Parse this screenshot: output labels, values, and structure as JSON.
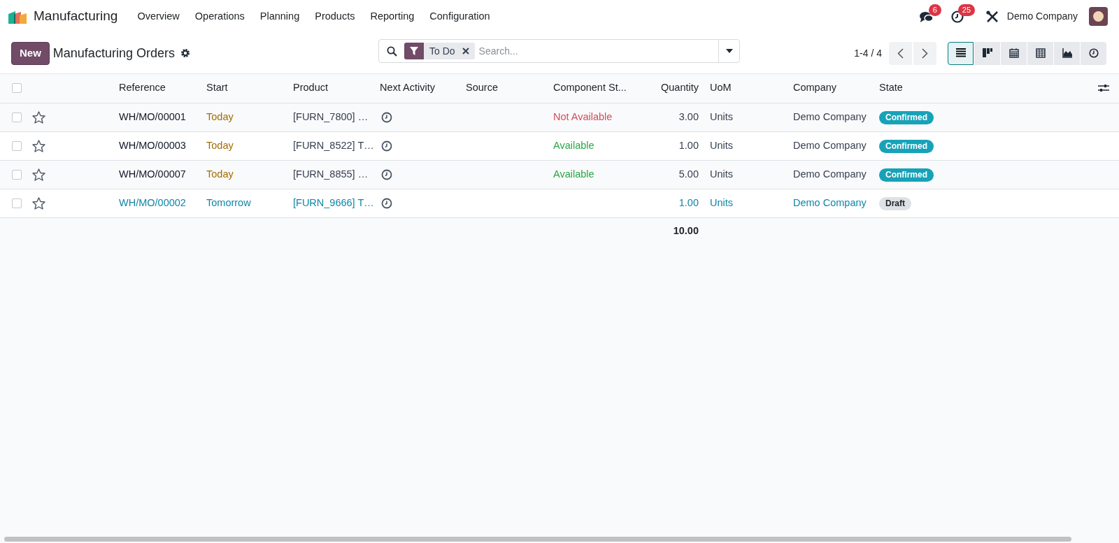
{
  "app": {
    "name": "Manufacturing"
  },
  "menu": [
    "Overview",
    "Operations",
    "Planning",
    "Products",
    "Reporting",
    "Configuration"
  ],
  "systray": {
    "messages_count": "6",
    "activities_count": "25",
    "company": "Demo Company"
  },
  "control_panel": {
    "new_button": "New",
    "title": "Manufacturing Orders",
    "facets": [
      {
        "label": "To Do"
      }
    ],
    "search_placeholder": "Search...",
    "pager": "1-4 / 4",
    "views": [
      {
        "kind": "list",
        "selected": true
      },
      {
        "kind": "kanban",
        "selected": false
      },
      {
        "kind": "calendar",
        "selected": false
      },
      {
        "kind": "pivot",
        "selected": false
      },
      {
        "kind": "graph",
        "selected": false
      },
      {
        "kind": "activity",
        "selected": false
      }
    ]
  },
  "table": {
    "select_all": {
      "checked": false
    },
    "columns": [
      "Reference",
      "Start",
      "Product",
      "Next Activity",
      "Source",
      "Component St...",
      "Quantity",
      "UoM",
      "Company",
      "State"
    ],
    "rows": [
      {
        "selected": false,
        "starred": false,
        "reference": "WH/MO/00001",
        "start": {
          "text": "Today",
          "kind": "today"
        },
        "product": "[FURN_7800] …",
        "component_status": {
          "text": "Not Available",
          "kind": "unavailable"
        },
        "quantity": "3.00",
        "uom": "Units",
        "company": "Demo Company",
        "state": {
          "label": "Confirmed",
          "kind": "confirmed"
        }
      },
      {
        "selected": false,
        "starred": false,
        "reference": "WH/MO/00003",
        "start": {
          "text": "Today",
          "kind": "today"
        },
        "product": "[FURN_8522] T…",
        "component_status": {
          "text": "Available",
          "kind": "available"
        },
        "quantity": "1.00",
        "uom": "Units",
        "company": "Demo Company",
        "state": {
          "label": "Confirmed",
          "kind": "confirmed"
        }
      },
      {
        "selected": false,
        "starred": false,
        "reference": "WH/MO/00007",
        "start": {
          "text": "Today",
          "kind": "today"
        },
        "product": "[FURN_8855] …",
        "component_status": {
          "text": "Available",
          "kind": "available"
        },
        "quantity": "5.00",
        "uom": "Units",
        "company": "Demo Company",
        "state": {
          "label": "Confirmed",
          "kind": "confirmed"
        }
      },
      {
        "selected": false,
        "starred": false,
        "reference": "WH/MO/00002",
        "start": {
          "text": "Tomorrow",
          "kind": "future"
        },
        "product": "[FURN_9666] T…",
        "quantity": "1.00",
        "uom": "Units",
        "company": "Demo Company",
        "state": {
          "label": "Draft",
          "kind": "draft"
        }
      }
    ],
    "total_quantity": "10.00"
  }
}
